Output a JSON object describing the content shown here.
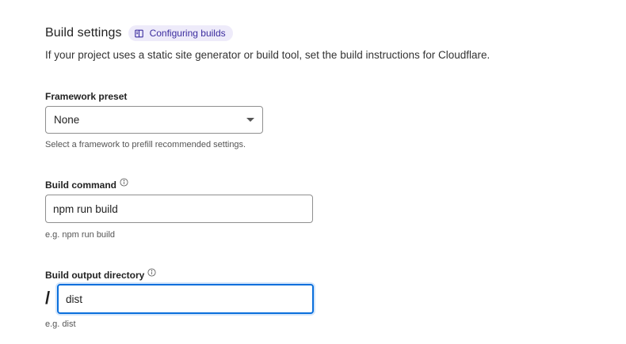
{
  "build_settings": {
    "heading": "Build settings",
    "docs_link": {
      "label": "Configuring builds",
      "icon": "book-icon"
    },
    "description": "If your project uses a static site generator or build tool, set the build instructions for Cloudflare."
  },
  "framework_preset": {
    "label": "Framework preset",
    "selected_value": "None",
    "helper": "Select a framework to prefill recommended settings."
  },
  "build_command": {
    "label": "Build command",
    "value": "npm run build",
    "helper": "e.g. npm run build"
  },
  "build_output_directory": {
    "label": "Build output directory",
    "prefix": "/",
    "value": "dist",
    "helper": "e.g. dist"
  },
  "colors": {
    "link_bg": "#eeebfa",
    "link_text": "#3b2c9e",
    "focus_border": "#0a6fdc"
  }
}
